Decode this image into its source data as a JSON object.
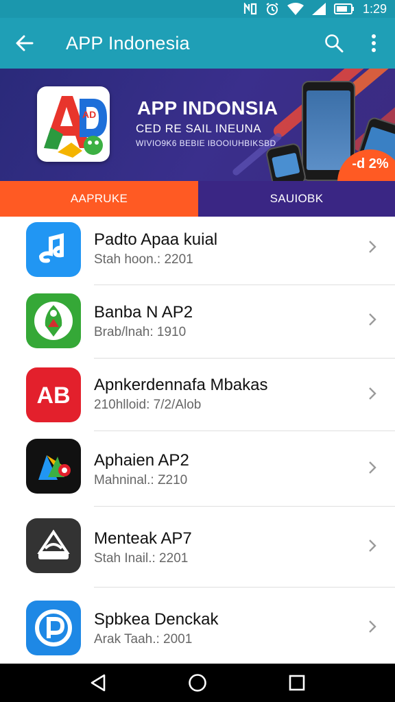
{
  "status_bar": {
    "time": "1:29",
    "icons": [
      "nfc-icon",
      "alarm-icon",
      "wifi-icon",
      "signal-icon",
      "battery-icon"
    ]
  },
  "app_bar": {
    "title": "APP Indonesia",
    "back_icon": "arrow-left-icon",
    "actions": [
      "search-icon",
      "more-vert-icon"
    ]
  },
  "banner": {
    "title": "APP INDONSIA",
    "subtitle": "CED RE SAIL INEUNA",
    "tagline": "WIVIO9K6 BEBIE IBOOIUHBIKSBD",
    "discount": "-d 2%",
    "logo_text": "AD"
  },
  "tabs": [
    {
      "label": "AAPRUKE",
      "active": true
    },
    {
      "label": "SAUIOBK",
      "active": false
    }
  ],
  "apps": [
    {
      "name": "Padto Apaa kuial",
      "subtitle": "Stah hoon.: 2201",
      "icon": "app-icon-blue-music",
      "color": "#2196f3"
    },
    {
      "name": "Banba N AP2",
      "subtitle": "Brab/lnah: 1910",
      "icon": "app-icon-green-leaf",
      "color": "#35a837"
    },
    {
      "name": "Apnkerdennafa Mbakas",
      "subtitle": "210hlloid: 7/2/Alob",
      "icon": "app-icon-red-ab",
      "color": "#e3202c"
    },
    {
      "name": "Aphaien AP2",
      "subtitle": "Mahninal.: Z210",
      "icon": "app-icon-black-play",
      "color": "#111111"
    },
    {
      "name": "Menteak AP7",
      "subtitle": "Stah Inail.: 2201",
      "icon": "app-icon-dark-hat",
      "color": "#333333"
    },
    {
      "name": "Spbkea Denckak",
      "subtitle": "Arak Taah.: 2001",
      "icon": "app-icon-blue-p",
      "color": "#1e88e5"
    }
  ],
  "colors": {
    "app_bar": "#1f9fb6",
    "status_bar": "#1b97ad",
    "tab_active": "#ff5a23",
    "tab_inactive": "#3a2684",
    "banner": "#2f2a80"
  },
  "nav": [
    "back-triangle-icon",
    "home-circle-icon",
    "recents-square-icon"
  ]
}
